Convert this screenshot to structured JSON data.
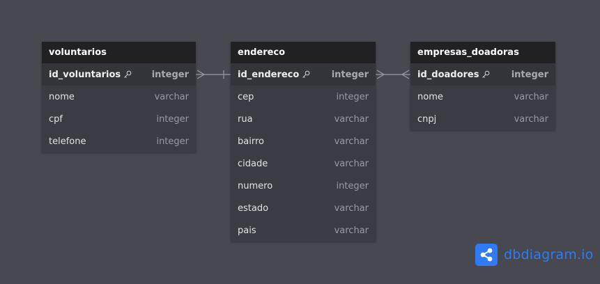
{
  "tables": [
    {
      "name": "voluntarios",
      "fields": [
        {
          "name": "id_voluntarios",
          "type": "integer",
          "pk": true
        },
        {
          "name": "nome",
          "type": "varchar",
          "pk": false
        },
        {
          "name": "cpf",
          "type": "integer",
          "pk": false
        },
        {
          "name": "telefone",
          "type": "integer",
          "pk": false
        }
      ]
    },
    {
      "name": "endereco",
      "fields": [
        {
          "name": "id_endereco",
          "type": "integer",
          "pk": true
        },
        {
          "name": "cep",
          "type": "integer",
          "pk": false
        },
        {
          "name": "rua",
          "type": "varchar",
          "pk": false
        },
        {
          "name": "bairro",
          "type": "varchar",
          "pk": false
        },
        {
          "name": "cidade",
          "type": "varchar",
          "pk": false
        },
        {
          "name": "numero",
          "type": "integer",
          "pk": false
        },
        {
          "name": "estado",
          "type": "varchar",
          "pk": false
        },
        {
          "name": "pais",
          "type": "varchar",
          "pk": false
        }
      ]
    },
    {
      "name": "empresas_doadoras",
      "fields": [
        {
          "name": "id_doadores",
          "type": "integer",
          "pk": true
        },
        {
          "name": "nome",
          "type": "varchar",
          "pk": false
        },
        {
          "name": "cnpj",
          "type": "varchar",
          "pk": false
        }
      ]
    }
  ],
  "relationships": [
    {
      "from": "voluntarios.id_voluntarios",
      "to": "endereco.id_endereco",
      "from_end": "many",
      "to_end": "one"
    },
    {
      "from": "endereco.id_endereco",
      "to": "empresas_doadoras.id_doadores",
      "from_end": "many",
      "to_end": "many"
    }
  ],
  "brand": {
    "text": "dbdiagram.io",
    "color": "#2f7bf6"
  },
  "colors": {
    "background": "#484851",
    "header": "#212124",
    "body": "#3b3b43"
  }
}
